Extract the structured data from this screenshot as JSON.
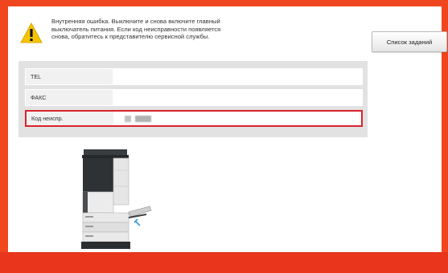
{
  "message": {
    "lines": [
      "Внутренняя ошибка. Выключите и снова включите главный",
      "выключатель питания.  Если код неисправности появляется",
      "снова, обратитесь к представителю сервисной службы."
    ],
    "icon": "warning-icon"
  },
  "buttons": {
    "job_list_label": "Список заданий"
  },
  "info_rows": [
    {
      "label": "TEL",
      "value": ""
    },
    {
      "label": "ФАКС",
      "value": ""
    },
    {
      "label": "Код неиспр.",
      "value": ""
    }
  ],
  "colors": {
    "frame": "#f0461f",
    "highlight": "#d9232e",
    "warning": "#f5c400"
  }
}
